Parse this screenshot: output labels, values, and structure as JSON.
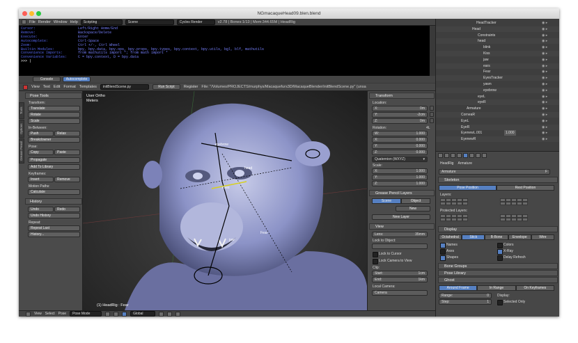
{
  "window": {
    "title": "NGmacaqueHead09.blen.blend"
  },
  "topbar": {
    "menus": [
      "File",
      "Render",
      "Window",
      "Help"
    ],
    "layout": "Scripting",
    "scene": "Scene",
    "engine": "Cycles Render",
    "stats": "v2.78 | Bones:1/13 | Mem:344.65M | HeadRig"
  },
  "console": {
    "lines": [
      [
        "Cursor:",
        "Left/Right Home/End"
      ],
      [
        "Remove:",
        "Backspace/Delete"
      ],
      [
        "Execute:",
        "Enter"
      ],
      [
        "Autocomplete:",
        "Ctrl-Space"
      ],
      [
        "Zoom:",
        "Ctrl +/-, Ctrl Wheel"
      ],
      [
        "Builtin Modules:",
        "bpy, bpy.data, bpy.ops, bpy.props, bpy.types, bpy.context, bpy.utils, bgl, blf, mathutils"
      ],
      [
        "Convenience Imports:",
        "from mathutils import *; from math import *"
      ],
      [
        "Convenience Variables:",
        "C = bpy.context, D = bpy.data"
      ]
    ],
    "prompt": ">>> |"
  },
  "console_bar": {
    "console": "Console",
    "autocomplete": "Autocomplete"
  },
  "text_editor": {
    "menus": [
      "View",
      "Text",
      "Edit",
      "Format",
      "Templates"
    ],
    "filename": "initBlendScene.py",
    "run": "Run Script",
    "register": "Register",
    "path": "File: \"/Volumes/PROJECTS/murphys/Macaquefurs3D/MacaqueBlender/initBlendScene.py\" (unsa"
  },
  "tools": {
    "header": "Pose Tools",
    "tabs": [
      "Tools",
      "Options",
      "Grease Pencil"
    ],
    "transform_label": "Transform:",
    "translate": "Translate",
    "rotate": "Rotate",
    "scale": "Scale",
    "inbetween_label": "In-Between:",
    "push": "Push",
    "relax": "Relax",
    "breakdowner": "Breakdowner",
    "pose_label": "Pose:",
    "copy": "Copy",
    "paste": "Paste",
    "propagate": "Propagate",
    "add_to_library": "Add To Library",
    "keyframes_label": "Keyframes:",
    "insert": "Insert",
    "remove": "Remove",
    "motion_paths_label": "Motion Paths:",
    "calculate": "Calculate",
    "history_header": "History",
    "undo": "Undo",
    "redo": "Redo",
    "undo_history": "Undo History",
    "repeat_label": "Repeat:",
    "repeat_last": "Repeat Last",
    "history": "History..."
  },
  "viewport": {
    "view": "User Ortho",
    "units": "Meters",
    "footer": "(1) HeadRig : Fear",
    "bone_labels": [
      "eyebrow",
      "head",
      "eyes",
      "Fear",
      "jaw"
    ]
  },
  "npanel": {
    "transform": "Transform",
    "location": "Location:",
    "loc": [
      [
        "X:",
        "0m"
      ],
      [
        "Y:",
        "-2cm"
      ],
      [
        "Z:",
        "0m"
      ]
    ],
    "rotation": "Rotation:",
    "rot_mode_tag": "4L",
    "rot": [
      [
        "W:",
        "1.000"
      ],
      [
        "X:",
        "0.000"
      ],
      [
        "Y:",
        "0.000"
      ],
      [
        "Z:",
        "0.000"
      ]
    ],
    "rot_mode": "Quaternion (WXYZ)",
    "scale": "Scale:",
    "scl": [
      [
        "X:",
        "1.000"
      ],
      [
        "Y:",
        "1.000"
      ],
      [
        "Z:",
        "1.000"
      ]
    ],
    "grease": "Grease Pencil Layers",
    "gp_scene": "Scene",
    "gp_object": "Object",
    "gp_new": "New",
    "gp_new_layer": "New Layer",
    "view": "View",
    "lens_label": "Lens:",
    "lens_value": "35mm",
    "lock_to_object": "Lock to Object:",
    "lock_to_cursor": "Lock to Cursor",
    "lock_camera": "Lock Camera to View",
    "clip": "Clip:",
    "clip_start_label": "Start:",
    "clip_start": "1cm",
    "clip_end_label": "End:",
    "clip_end": "1km",
    "local_camera": "Local Camera:",
    "camera": "Camera"
  },
  "outliner": {
    "rows": [
      "HeadTracker",
      "Head",
      "Constraints",
      "head",
      "blink",
      "Kiss",
      "jaw",
      "ears",
      "Fear",
      "EyesTracker",
      "yawn",
      "eyebrow",
      "eyeL",
      "eyeR",
      "Armature",
      "CorneaR",
      "EyeL",
      "EyeR",
      "EyenewL.001",
      "EyenewR"
    ],
    "eyenewl_value": "1.000"
  },
  "props": {
    "object": "HeadRig",
    "armature_label": "Armature",
    "armature_name": "Armature",
    "armature_key": "F",
    "skeleton": "Skeleton",
    "pose_position": "Pose Position",
    "rest_position": "Rest Position",
    "layers": "Layers:",
    "protected_layers": "Protected Layers:",
    "display": "Display",
    "display_modes": [
      "Octahedral",
      "Stick",
      "B-Bone",
      "Envelope",
      "Wire"
    ],
    "names": "Names",
    "colors": "Colors",
    "axes": "Axes",
    "xray": "X-Ray",
    "shapes": "Shapes",
    "delay_refresh": "Delay Refresh",
    "bone_groups": "Bone Groups",
    "pose_library": "Pose Library",
    "ghost": "Ghost",
    "ghost_modes": [
      "Around Frame",
      "In Range",
      "On Keyframes"
    ],
    "range_label": "Range:",
    "range": "0",
    "display_label": "Display:",
    "step_label": "Step:",
    "step": "1",
    "selected_only": "Selected Only"
  },
  "bottombar": {
    "menus": [
      "View",
      "Select",
      "Pose"
    ],
    "mode": "Pose Mode",
    "orientation": "Global"
  },
  "colors": {
    "accent": "#5680c2",
    "console_text": "#7780ff",
    "bone_line": "#000000",
    "ape_fur": "#8c93c7"
  }
}
